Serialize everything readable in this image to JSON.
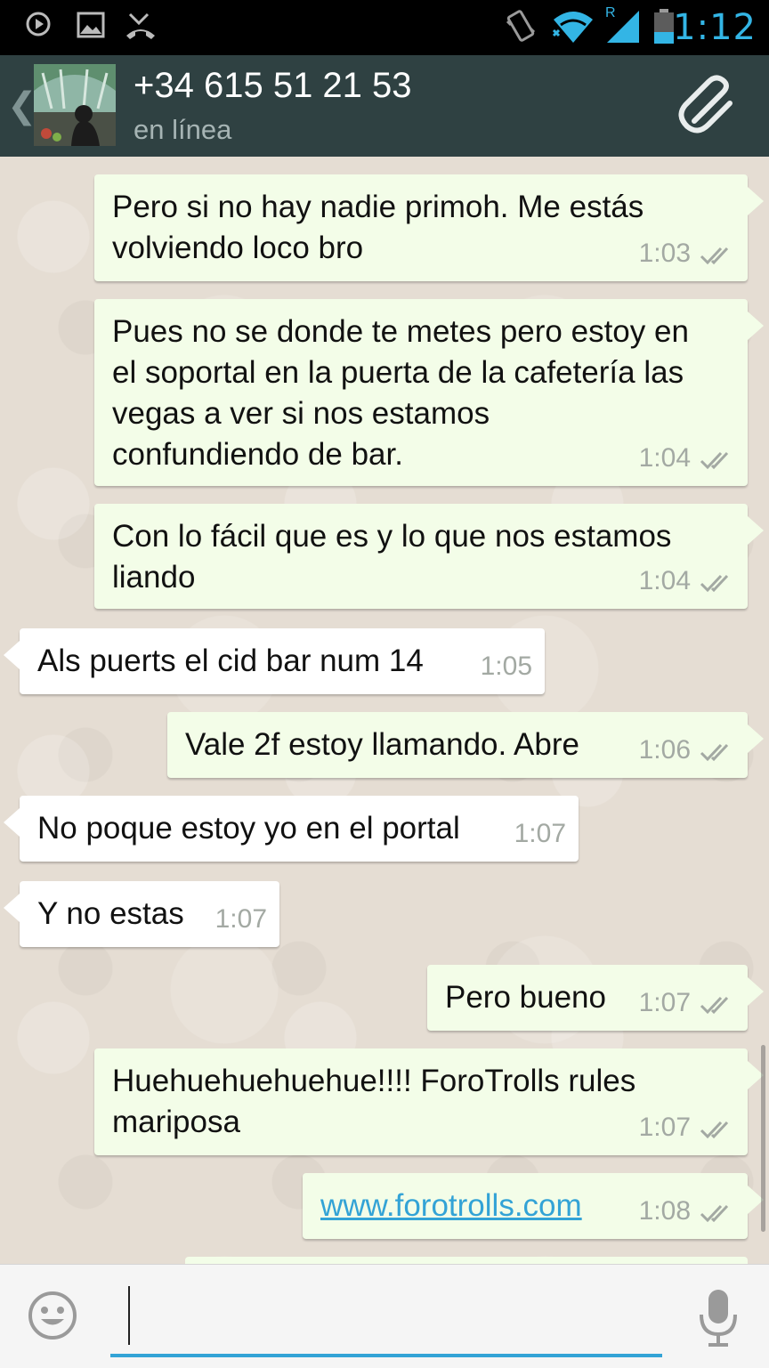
{
  "status_bar": {
    "time": "1:12",
    "left_icons": [
      "play-circle-icon",
      "image-icon",
      "missed-call-icon"
    ],
    "right_icons": [
      "vibrate-icon",
      "wifi-icon",
      "signal-icon",
      "battery-icon"
    ],
    "signal_label": "R"
  },
  "header": {
    "contact_name": "+34 615 51 21 53",
    "status": "en línea",
    "back_glyph": "❮"
  },
  "messages": [
    {
      "direction": "out",
      "text_lines": [
        "Pero si no hay nadie primoh. Me estás",
        "volviendo loco bro"
      ],
      "time": "1:03",
      "ticks": true
    },
    {
      "direction": "out",
      "text_lines": [
        "Pues no se donde te metes pero estoy en",
        "el soportal en la puerta de la cafetería las",
        "vegas a ver si nos estamos",
        "confundiendo de bar."
      ],
      "time": "1:04",
      "ticks": true
    },
    {
      "direction": "out",
      "text_lines": [
        "Con lo fácil que es y lo que nos estamos",
        "liando"
      ],
      "time": "1:04",
      "ticks": true
    },
    {
      "direction": "in",
      "text_lines": [
        "Als puerts el cid bar num 14"
      ],
      "time": "1:05",
      "ticks": false
    },
    {
      "direction": "out",
      "text_lines": [
        "Vale 2f estoy llamando. Abre"
      ],
      "time": "1:06",
      "ticks": true
    },
    {
      "direction": "in",
      "text_lines": [
        "No poque estoy yo en el portal"
      ],
      "time": "1:07",
      "ticks": false
    },
    {
      "direction": "in",
      "text_lines": [
        "Y no estas"
      ],
      "time": "1:07",
      "ticks": false
    },
    {
      "direction": "out",
      "text_lines": [
        "Pero bueno"
      ],
      "time": "1:07",
      "ticks": true
    },
    {
      "direction": "out",
      "text_lines": [
        "Huehuehuehuehue!!!! ForoTrolls rules",
        "mariposa"
      ],
      "time": "1:07",
      "ticks": true
    },
    {
      "direction": "out",
      "text_lines": [
        "www.forotrolls.com"
      ],
      "time": "1:08",
      "ticks": true,
      "is_link": true
    }
  ],
  "input": {
    "value": "",
    "placeholder": ""
  },
  "colors": {
    "accent": "#33b5e5",
    "action_bar": "#2f4142",
    "outgoing_bubble": "#f3fde8",
    "incoming_bubble": "#ffffff",
    "chat_background": "#e5ddd3"
  }
}
